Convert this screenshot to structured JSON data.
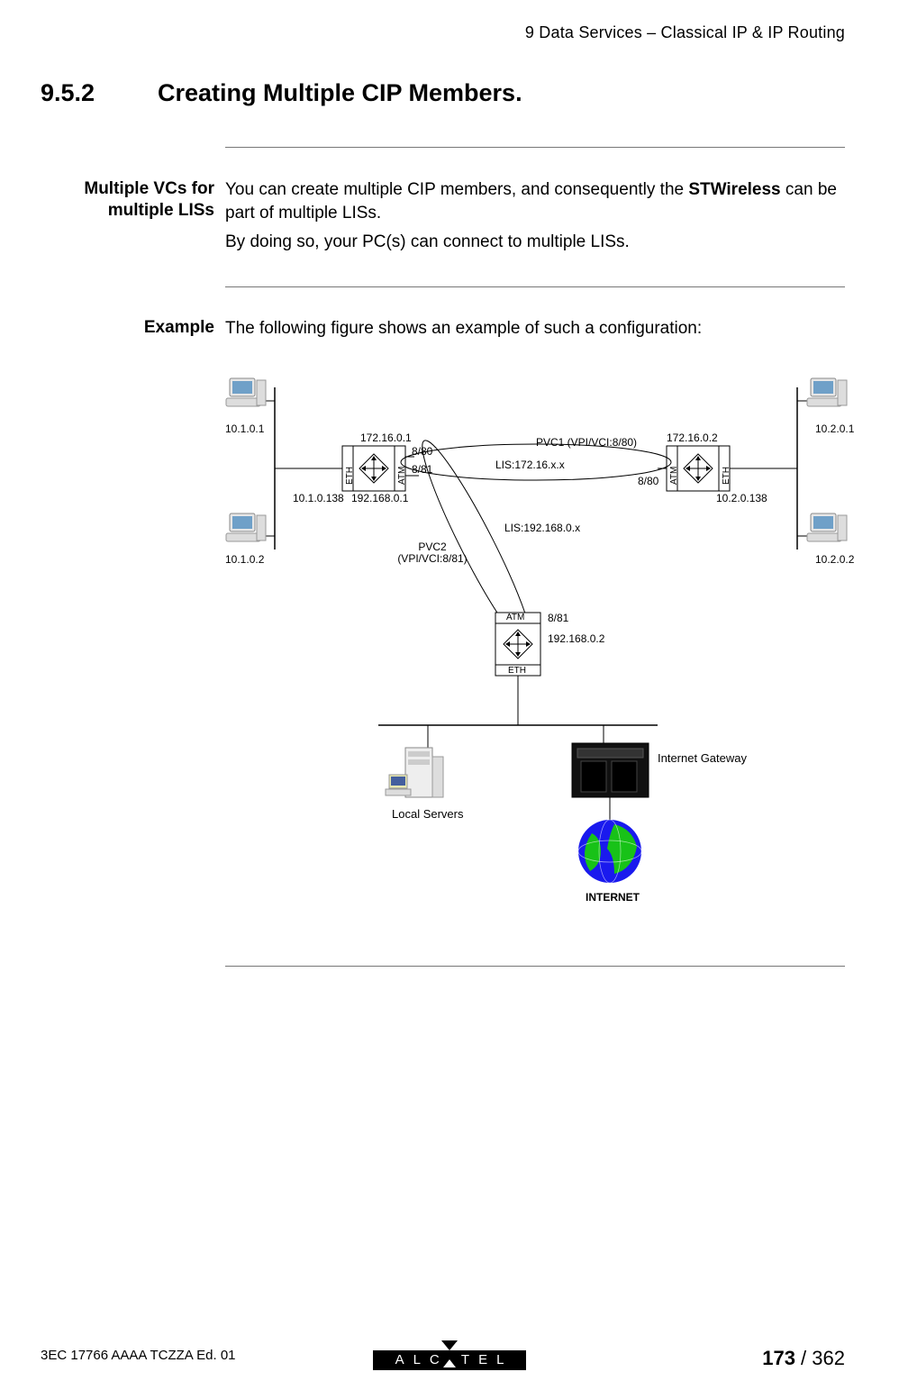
{
  "running_head": "9   Data Services – Classical IP & IP Routing",
  "section_number": "9.5.2",
  "section_title": "Creating Multiple CIP Members.",
  "blocks": {
    "vcs": {
      "side": "Multiple VCs for multiple LISs",
      "p1a": "You can create multiple CIP members, and consequently the ",
      "bold": "STWireless",
      "p1b": " can be part of multiple LISs.",
      "p2": "By doing so, your PC(s) can connect to multiple LISs."
    },
    "example": {
      "side": "Example",
      "p1": "The following figure shows an example of such a configuration:"
    }
  },
  "diagram": {
    "pc_left_top": "10.1.0.1",
    "pc_left_bottom": "10.1.0.2",
    "pc_right_top": "10.2.0.1",
    "pc_right_bottom": "10.2.0.2",
    "left_box_eth": "ETH",
    "left_box_atm": "ATM",
    "left_ip_top": "172.16.0.1",
    "left_ip_eth": "10.1.0.138",
    "left_ip_bottom": "192.168.0.1",
    "right_box_eth": "ETH",
    "right_box_atm": "ATM",
    "right_ip_top": "172.16.0.2",
    "right_ip_eth": "10.2.0.138",
    "port_8_80_l": "8/80",
    "port_8_81_l": "8/81",
    "port_8_80_r": "8/80",
    "pvc1": "PVC1 (VPI/VCI:8/80)",
    "lis1": "LIS:172.16.x.x",
    "lis2": "LIS:192.168.0.x",
    "pvc2_l1": "PVC2",
    "pvc2_l2": "(VPI/VCI:8/81)",
    "mid_box_atm": "ATM",
    "mid_box_eth": "ETH",
    "mid_port": "8/81",
    "mid_ip": "192.168.0.2",
    "local_servers": "Local Servers",
    "gateway": "Internet Gateway",
    "internet": "INTERNET"
  },
  "footer": {
    "left": "3EC 17766 AAAA TCZZA Ed. 01",
    "page_current": "173",
    "page_sep": " / ",
    "page_total": "362",
    "brand": "ALCATEL"
  }
}
